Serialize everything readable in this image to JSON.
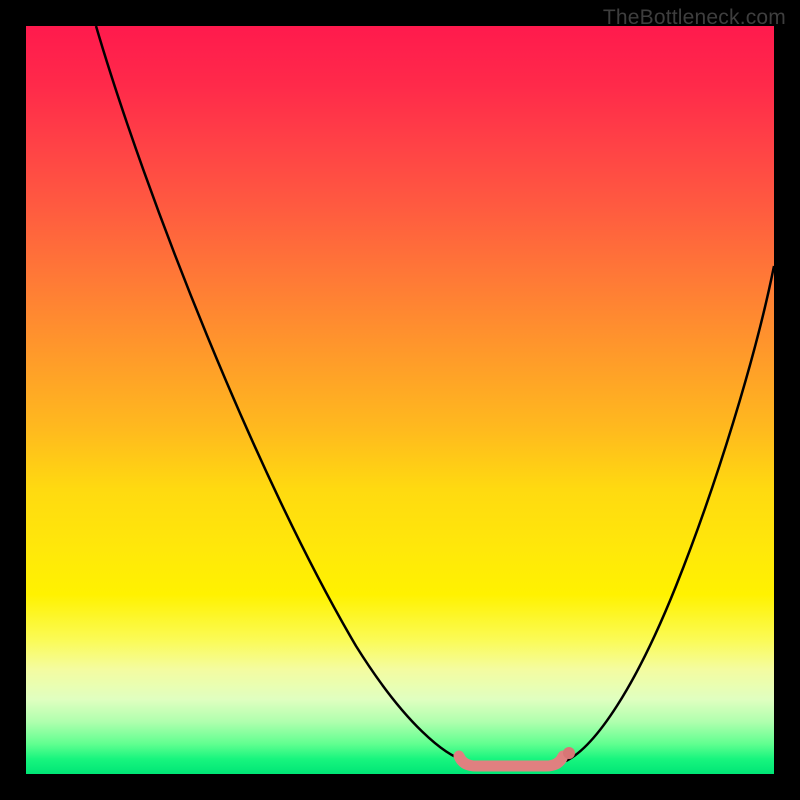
{
  "watermark": {
    "text": "TheBottleneck.com"
  },
  "colors": {
    "curve": "#000000",
    "floor_accent": "#e08080",
    "dot": "#d87676"
  },
  "chart_data": {
    "type": "line",
    "title": "",
    "xlabel": "",
    "ylabel": "",
    "xlim": [
      0,
      100
    ],
    "ylim": [
      0,
      100
    ],
    "grid": false,
    "series": [
      {
        "name": "left-curve",
        "x": [
          10,
          15,
          20,
          25,
          30,
          35,
          40,
          45,
          50,
          55,
          58
        ],
        "values": [
          100,
          90,
          79,
          68,
          57,
          46,
          35,
          24,
          13,
          4,
          0
        ]
      },
      {
        "name": "right-curve",
        "x": [
          72,
          75,
          80,
          85,
          90,
          95,
          100
        ],
        "values": [
          0,
          3,
          12,
          24,
          38,
          53,
          70
        ]
      },
      {
        "name": "floor-segment",
        "x": [
          58,
          60,
          62,
          64,
          66,
          68,
          70,
          72
        ],
        "values": [
          0,
          0,
          0,
          0,
          0,
          0,
          0,
          0
        ]
      }
    ],
    "annotations": [
      {
        "name": "dot",
        "x": 72,
        "y": 2
      }
    ]
  }
}
